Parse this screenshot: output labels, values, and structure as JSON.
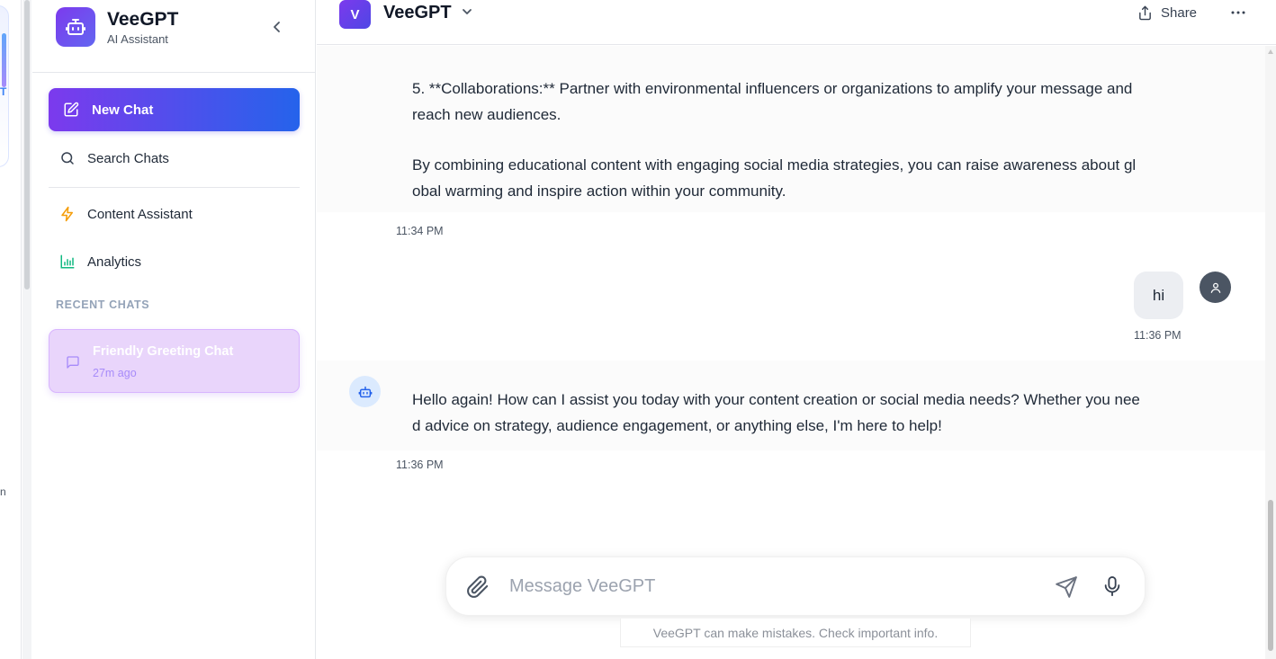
{
  "left_strip": {
    "partial_text_top": "T",
    "partial_text_bottom": "n"
  },
  "brand": {
    "name": "VeeGPT",
    "subtitle": "AI Assistant",
    "icon": "robot-icon"
  },
  "sidebar": {
    "new_chat_label": "New Chat",
    "search_label": "Search Chats",
    "nav": [
      {
        "label": "Content Assistant",
        "icon": "lightning-icon",
        "color": "#f59e0b"
      },
      {
        "label": "Analytics",
        "icon": "bar-chart-icon",
        "color": "#10b981"
      }
    ],
    "recent_title": "RECENT CHATS",
    "recent_chats": [
      {
        "title": "Friendly Greeting Chat",
        "time": "27m ago",
        "icon": "message-icon"
      }
    ]
  },
  "header": {
    "model_badge": "V",
    "model_name": "VeeGPT",
    "share_label": "Share"
  },
  "messages": {
    "bot_1": {
      "para_1": "5. **Collaborations:** Partner with environmental influencers or organizations to amplify your message and reach new audiences.",
      "para_2": "By combining educational content with engaging social media strategies, you can raise awareness about global warming and inspire action within your community.",
      "time": "11:34 PM"
    },
    "user_1": {
      "text": "hi",
      "time": "11:36 PM"
    },
    "bot_2": {
      "text": "Hello again! How can I assist you today with your content creation or social media needs? Whether you need advice on strategy, audience engagement, or anything else, I'm here to help!",
      "time": "11:36 PM"
    }
  },
  "composer": {
    "placeholder": "Message VeeGPT",
    "value": "",
    "disclaimer": "VeeGPT can make mistakes. Check important info."
  },
  "colors": {
    "accent_start": "#7c3aed",
    "accent_end": "#2563eb",
    "recent_bg": "#e9d5fb"
  }
}
